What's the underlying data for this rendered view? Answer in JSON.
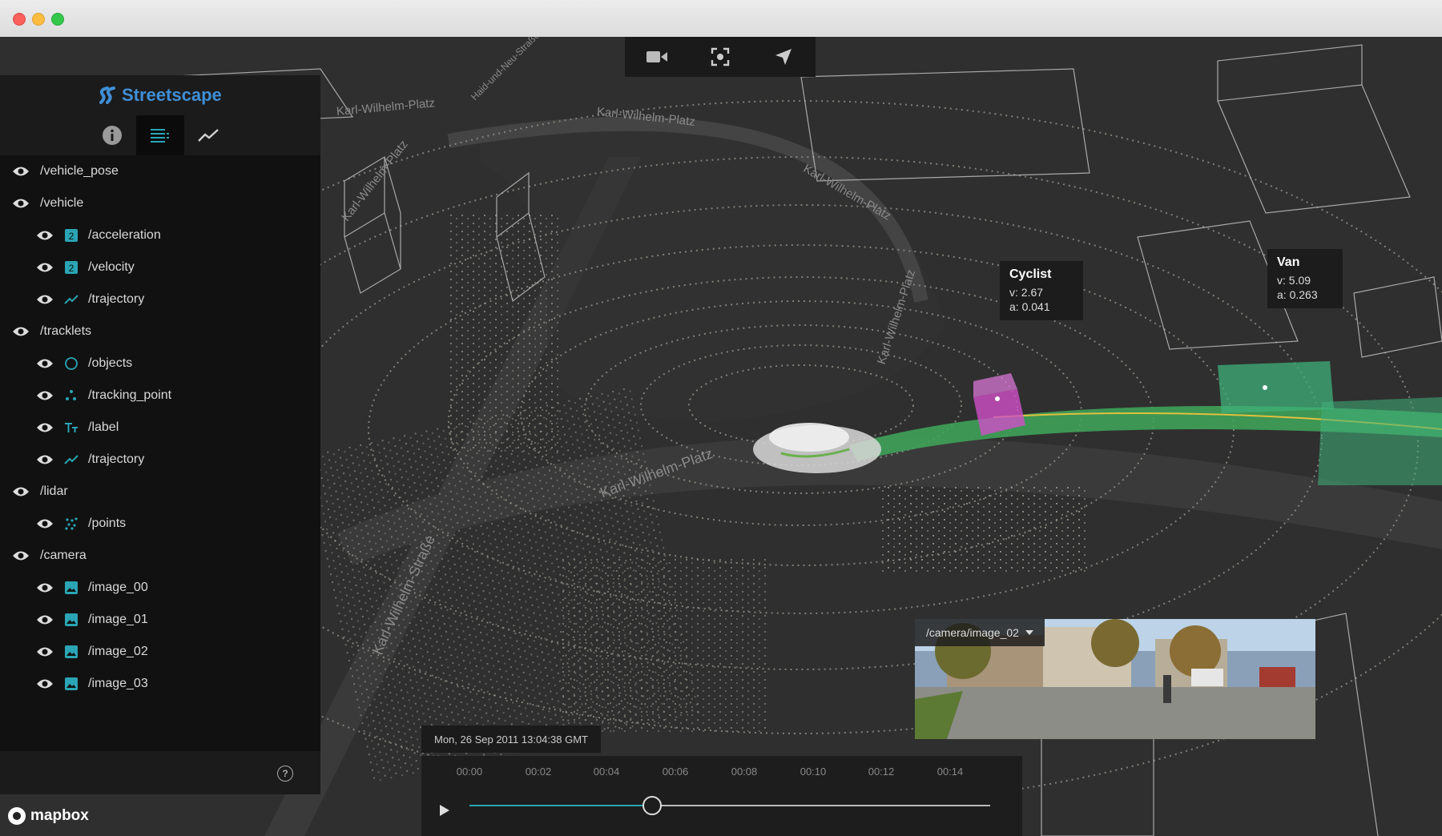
{
  "app": {
    "name": "Streetscape",
    "accent": "#3f8fd6"
  },
  "toolbar": {
    "buttons": [
      "camera-icon",
      "recenter-icon",
      "navigate-icon"
    ]
  },
  "sidebar": {
    "tabs": [
      {
        "icon": "info-icon",
        "active": false
      },
      {
        "icon": "streams-list-icon",
        "active": true
      },
      {
        "icon": "metrics-chart-icon",
        "active": false
      }
    ],
    "streams": [
      {
        "label": "/vehicle_pose",
        "level": 0,
        "icon": null
      },
      {
        "label": "/vehicle",
        "level": 0,
        "icon": null
      },
      {
        "label": "/acceleration",
        "level": 1,
        "icon": "number-icon"
      },
      {
        "label": "/velocity",
        "level": 1,
        "icon": "number-icon"
      },
      {
        "label": "/trajectory",
        "level": 1,
        "icon": "polyline-icon"
      },
      {
        "label": "/tracklets",
        "level": 0,
        "icon": null
      },
      {
        "label": "/objects",
        "level": 1,
        "icon": "circle-icon"
      },
      {
        "label": "/tracking_point",
        "level": 1,
        "icon": "points-icon"
      },
      {
        "label": "/label",
        "level": 1,
        "icon": "text-icon"
      },
      {
        "label": "/trajectory",
        "level": 1,
        "icon": "polyline-icon"
      },
      {
        "label": "/lidar",
        "level": 0,
        "icon": null
      },
      {
        "label": "/points",
        "level": 1,
        "icon": "scatter-icon"
      },
      {
        "label": "/camera",
        "level": 0,
        "icon": null
      },
      {
        "label": "/image_00",
        "level": 1,
        "icon": "image-icon"
      },
      {
        "label": "/image_01",
        "level": 1,
        "icon": "image-icon"
      },
      {
        "label": "/image_02",
        "level": 1,
        "icon": "image-icon"
      },
      {
        "label": "/image_03",
        "level": 1,
        "icon": "image-icon"
      }
    ],
    "help": "?"
  },
  "map": {
    "attribution": "mapbox",
    "streets": [
      {
        "text": "Karl-Wilhelm-Platz",
        "id": "s1"
      },
      {
        "text": "Karl-Wilhelm-Platz",
        "id": "s2"
      },
      {
        "text": "Karl-Wilhelm-Platz",
        "id": "s3"
      },
      {
        "text": "Karl-Wilhelm-Platz",
        "id": "s4"
      },
      {
        "text": "Karl-Wilhelm-Platz",
        "id": "s5"
      },
      {
        "text": "Karl-Wilhelm-Platz",
        "id": "s6"
      },
      {
        "text": "Karl-Wilhelm-Straße",
        "id": "s7"
      },
      {
        "text": "Haid-und-Neu-Straße",
        "id": "s8"
      }
    ]
  },
  "objects": {
    "cyclist": {
      "title": "Cyclist",
      "v": "v: 2.67",
      "a": "a: 0.041"
    },
    "van": {
      "title": "Van",
      "v": "v: 5.09",
      "a": "a: 0.263"
    }
  },
  "camera": {
    "selected": "/camera/image_02"
  },
  "playback": {
    "timestamp": "Mon, 26 Sep 2011 13:04:38 GMT",
    "ticks": [
      "00:00",
      "00:02",
      "00:04",
      "00:06",
      "00:08",
      "00:10",
      "00:12",
      "00:14"
    ],
    "progress": 0.35,
    "track_color": "#2aa5b5"
  }
}
